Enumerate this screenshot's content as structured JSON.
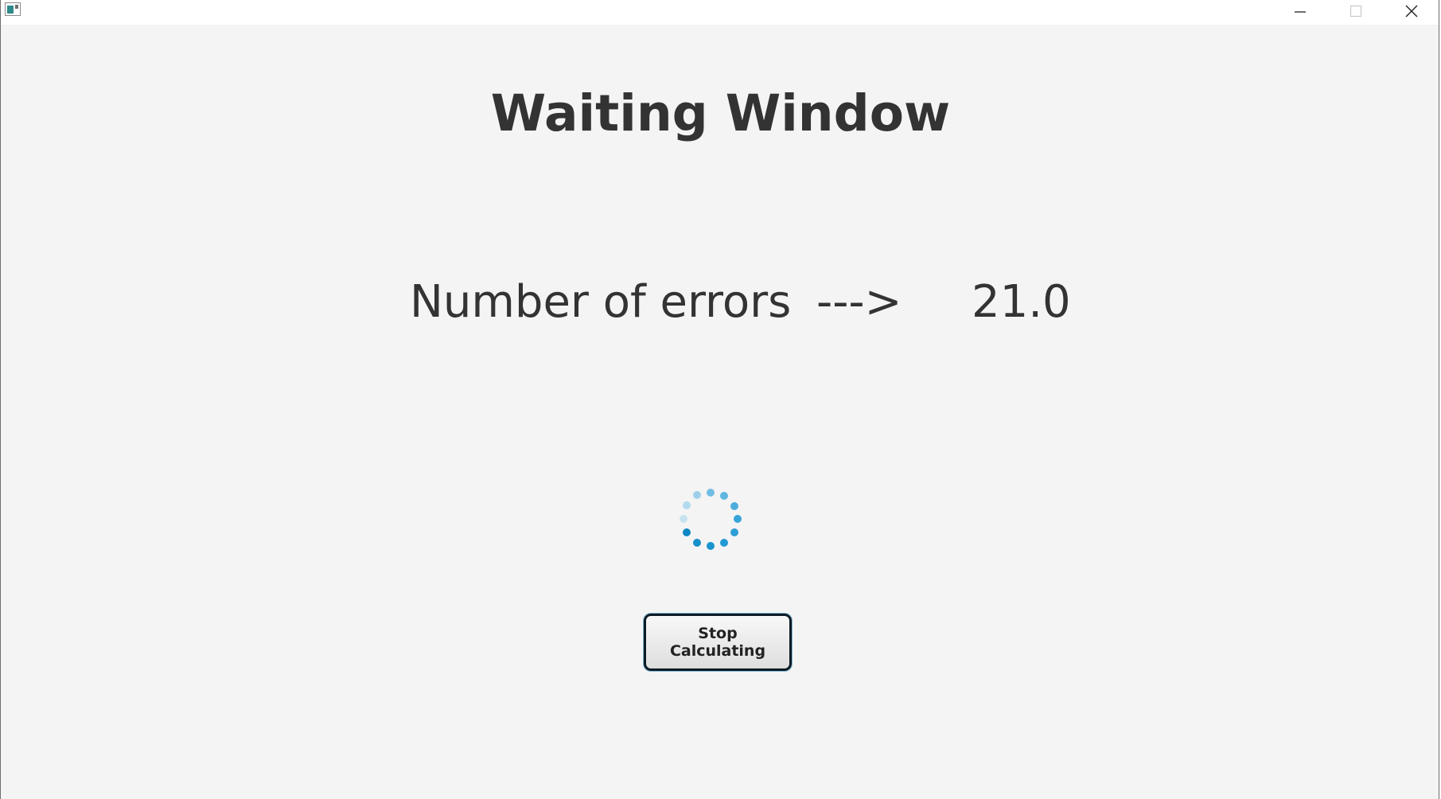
{
  "window": {
    "minimize_icon": "minimize-icon",
    "maximize_icon": "maximize-icon",
    "close_icon": "close-icon",
    "app_icon": "java-app-icon"
  },
  "main": {
    "title": "Waiting Window",
    "errors_label": "Number of errors",
    "arrow": "--->",
    "errors_value": "21.0",
    "spinner_icon": "loading-spinner-icon",
    "stop_button_label": "Stop Calculating"
  },
  "colors": {
    "text": "#333333",
    "spinner": "#1e9bd7",
    "background": "#f4f4f4"
  }
}
